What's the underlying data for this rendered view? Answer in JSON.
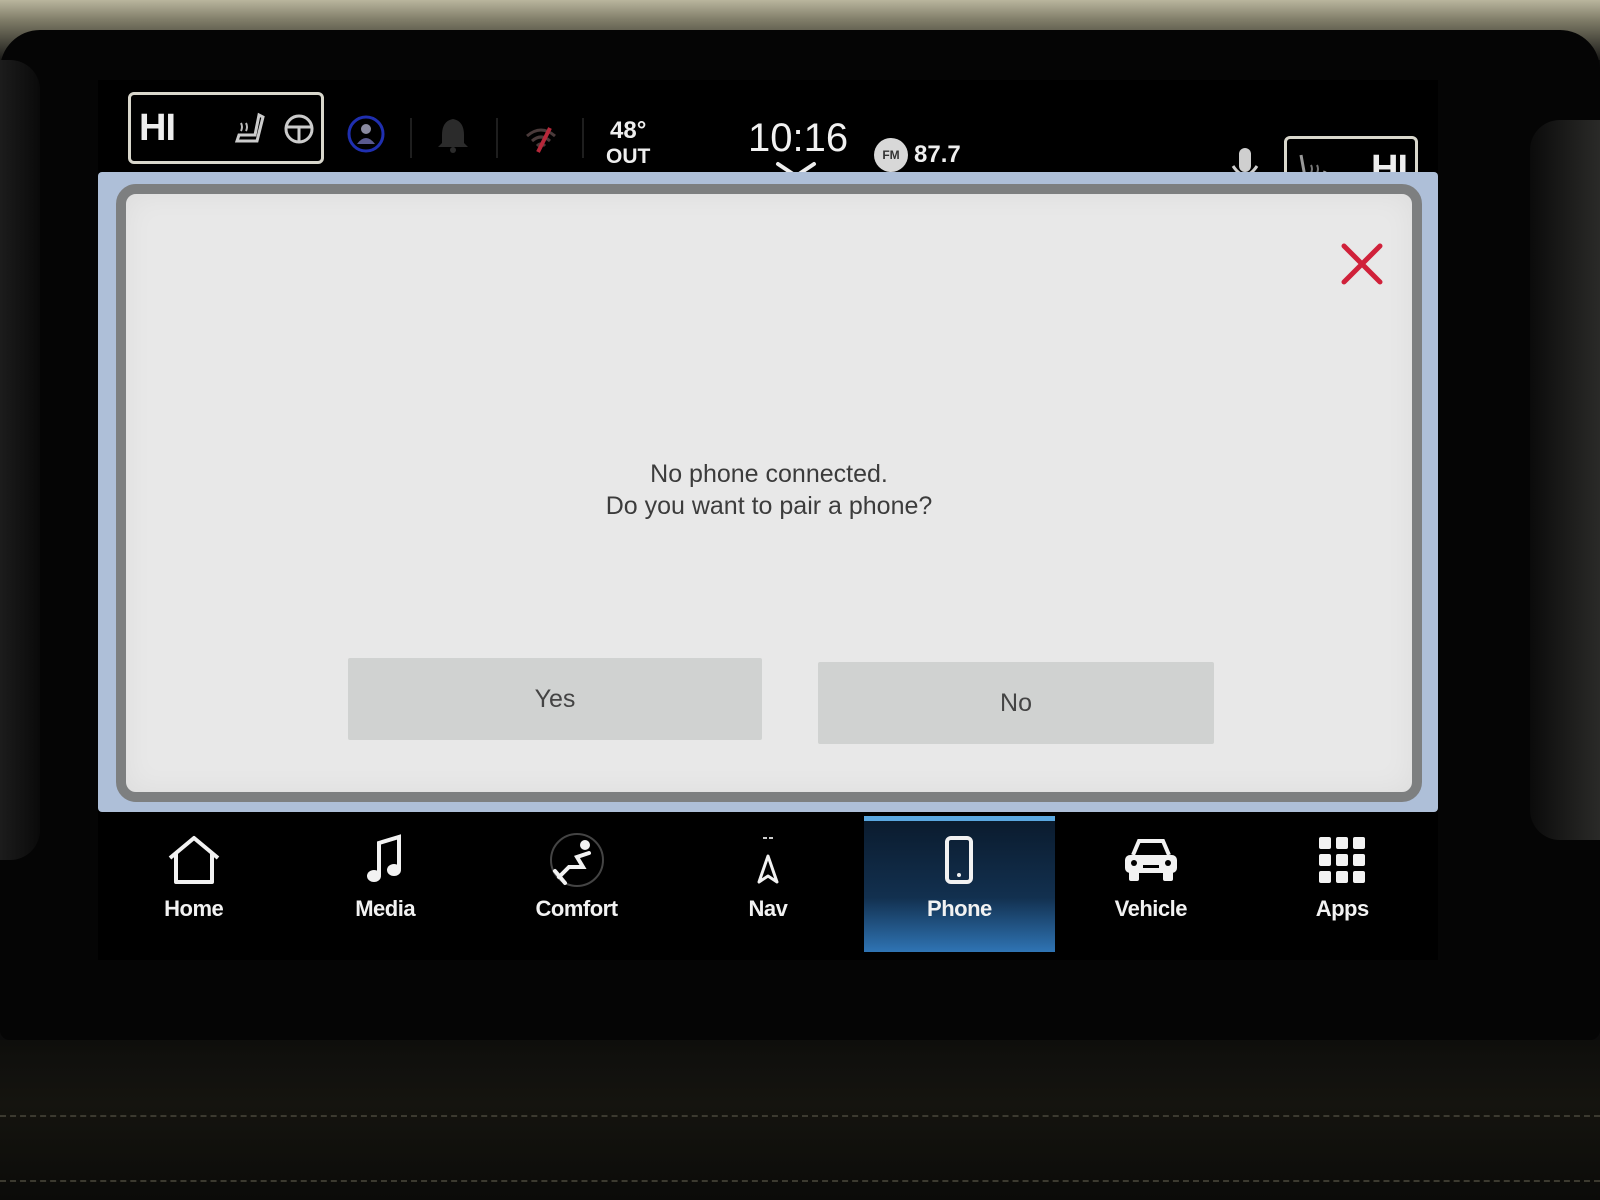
{
  "status_bar": {
    "driver_seat": {
      "level": "HI",
      "icons": [
        "seat-heat-icon",
        "steering-wheel-heat-icon"
      ]
    },
    "passenger_seat": {
      "level": "HI",
      "icons": [
        "seat-heat-icon"
      ]
    },
    "indicators": [
      "driver-profile-icon",
      "notification-bell-icon",
      "wifi-disabled-icon"
    ],
    "temperature": {
      "value": "48°",
      "label": "OUT"
    },
    "clock": "10:16",
    "radio": {
      "band": "FM",
      "frequency": "87.7"
    },
    "voice": "microphone-icon"
  },
  "dialog": {
    "message_line1": "No phone connected.",
    "message_line2": "Do you want to pair a phone?",
    "yes_label": "Yes",
    "no_label": "No",
    "close_icon": "close-icon"
  },
  "nav": {
    "active": "Phone",
    "items": [
      {
        "label": "Home",
        "icon": "home-icon"
      },
      {
        "label": "Media",
        "icon": "music-note-icon"
      },
      {
        "label": "Comfort",
        "icon": "seat-comfort-icon"
      },
      {
        "label": "Nav",
        "icon": "navigation-arrow-icon"
      },
      {
        "label": "Phone",
        "icon": "phone-icon"
      },
      {
        "label": "Vehicle",
        "icon": "car-icon"
      },
      {
        "label": "Apps",
        "icon": "apps-grid-icon"
      }
    ]
  },
  "colors": {
    "accent_active": "#2f74b4",
    "close_red": "#d0213a",
    "dialog_bg": "#e8e8e8",
    "button_bg": "#d0d2d1"
  }
}
